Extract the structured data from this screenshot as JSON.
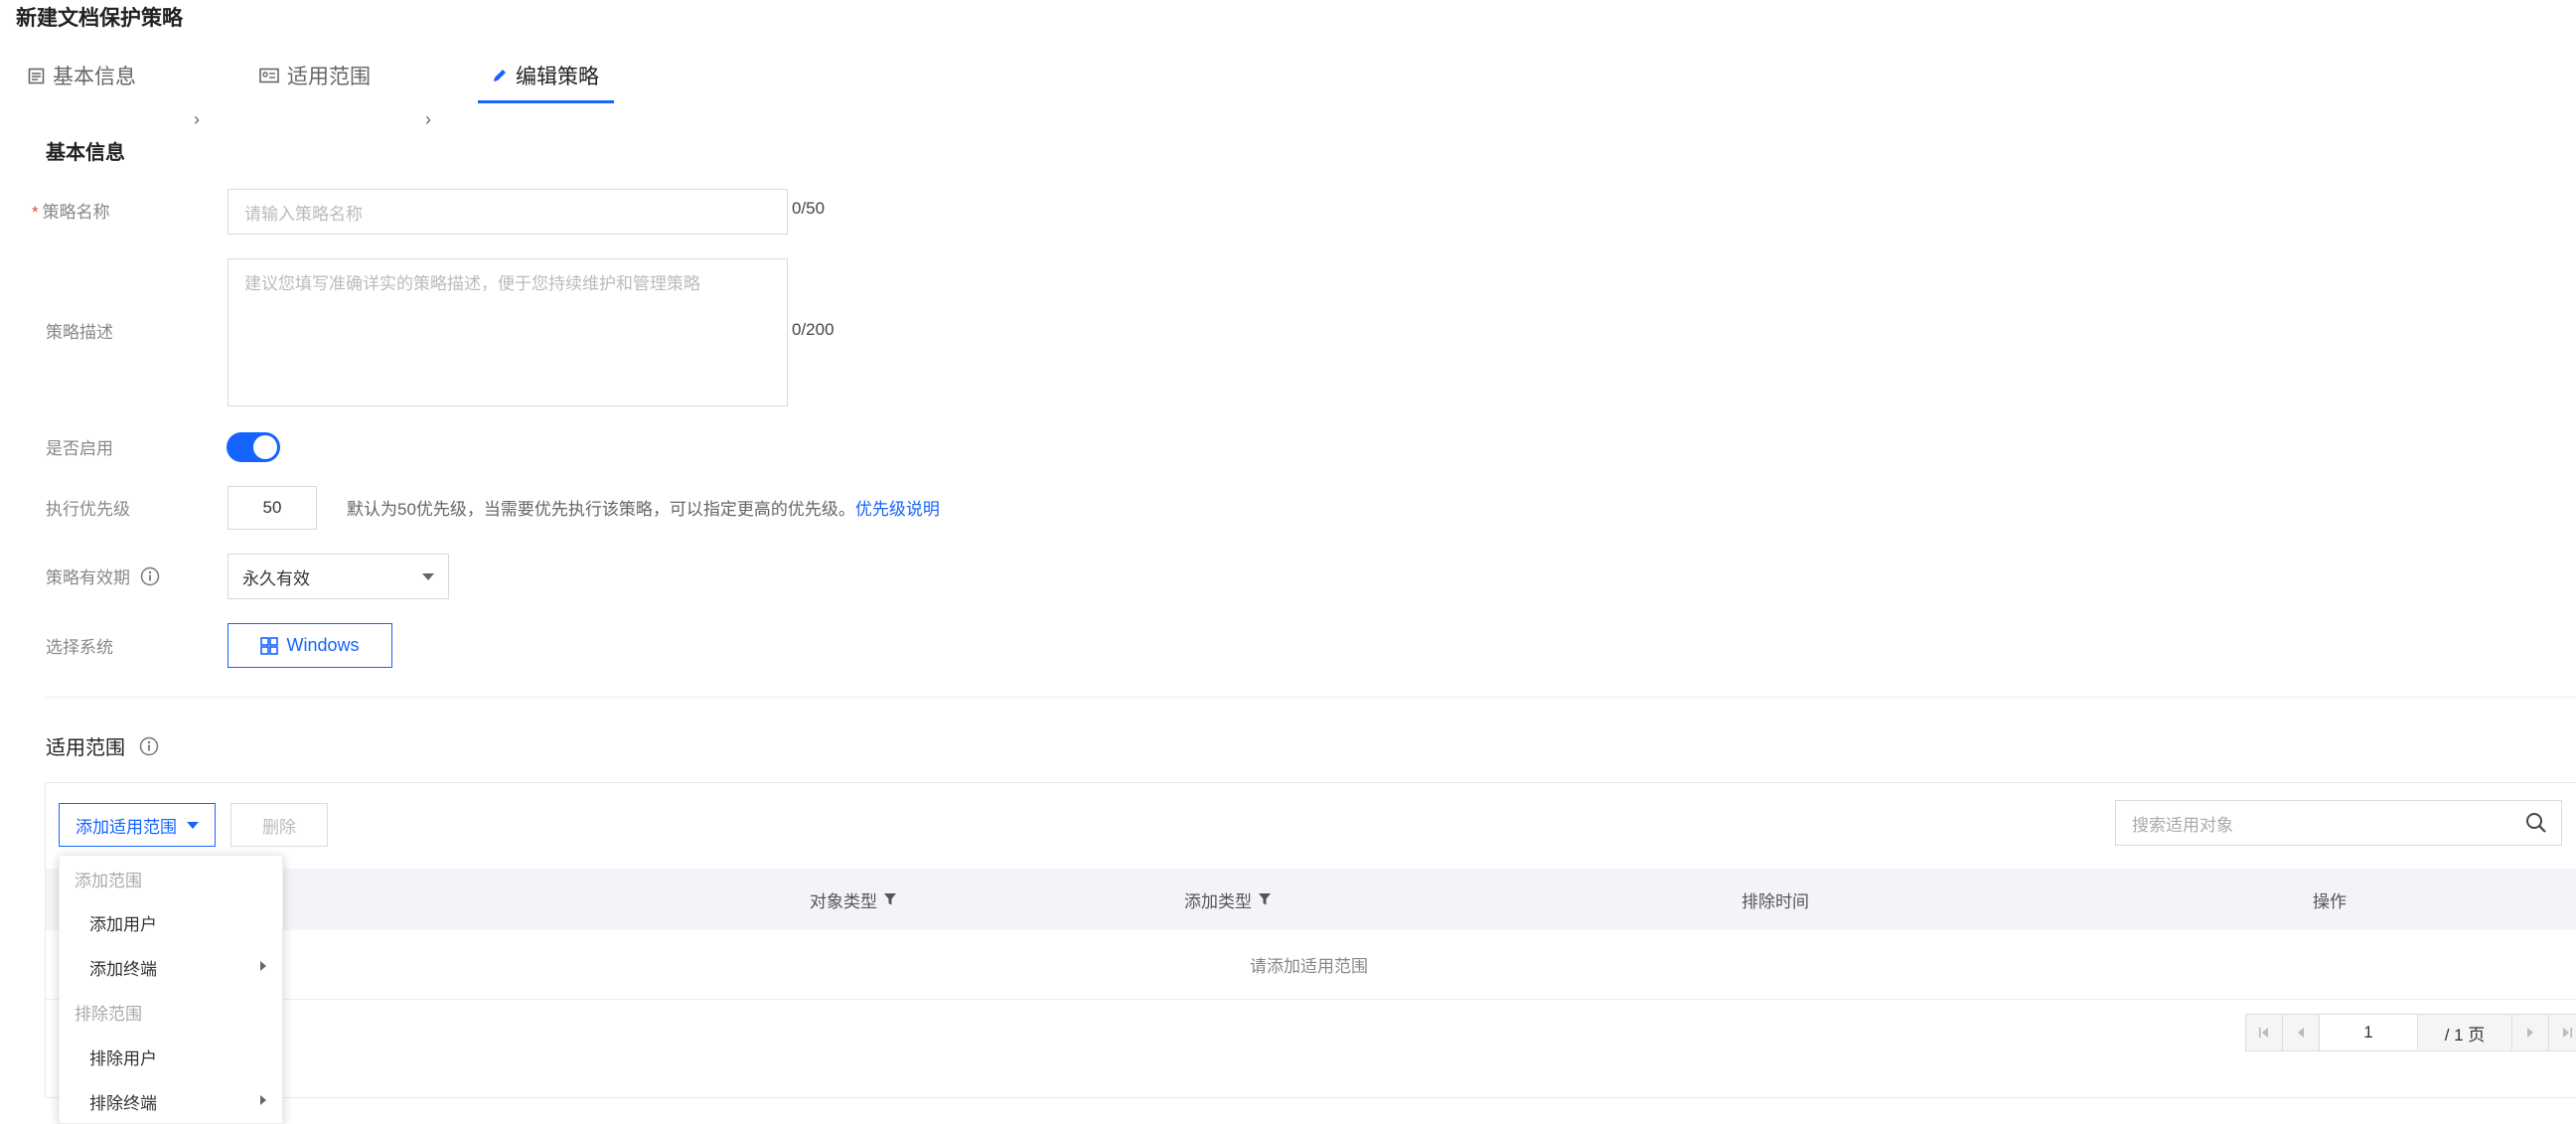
{
  "page": {
    "title": "新建文档保护策略"
  },
  "steps": [
    {
      "label": "基本信息",
      "icon": "form-icon"
    },
    {
      "label": "适用范围",
      "icon": "scope-card-icon"
    },
    {
      "label": "编辑策略",
      "icon": "pencil-icon",
      "active": true
    }
  ],
  "basic": {
    "section_title": "基本信息",
    "name": {
      "label": "策略名称",
      "required_mark": "*",
      "placeholder": "请输入策略名称",
      "counter": "0/50"
    },
    "desc": {
      "label": "策略描述",
      "placeholder": "建议您填写准确详实的策略描述，便于您持续维护和管理策略",
      "counter": "0/200"
    },
    "enable": {
      "label": "是否启用",
      "value": true
    },
    "priority": {
      "label": "执行优先级",
      "value": "50",
      "hint": "默认为50优先级，当需要优先执行该策略，可以指定更高的优先级。",
      "link": "优先级说明"
    },
    "validity": {
      "label": "策略有效期",
      "value": "永久有效"
    },
    "system": {
      "label": "选择系统",
      "value": "Windows"
    }
  },
  "scope": {
    "section_title": "适用范围",
    "add_button": "添加适用范围",
    "delete_button": "删除",
    "search_placeholder": "搜索适用对象",
    "columns": [
      "对象类型",
      "添加类型",
      "排除时间",
      "操作"
    ],
    "empty_text": "请添加适用范围",
    "pagination": {
      "current": "1",
      "total": "/ 1 页"
    }
  },
  "dropdown": {
    "groups": [
      {
        "title": "添加范围",
        "items": [
          {
            "label": "添加用户",
            "submenu": false
          },
          {
            "label": "添加终端",
            "submenu": true
          }
        ]
      },
      {
        "title": "排除范围",
        "items": [
          {
            "label": "排除用户",
            "submenu": false
          },
          {
            "label": "排除终端",
            "submenu": true
          }
        ]
      }
    ]
  },
  "colors": {
    "accent": "#1664ff",
    "required": "#e54545"
  }
}
